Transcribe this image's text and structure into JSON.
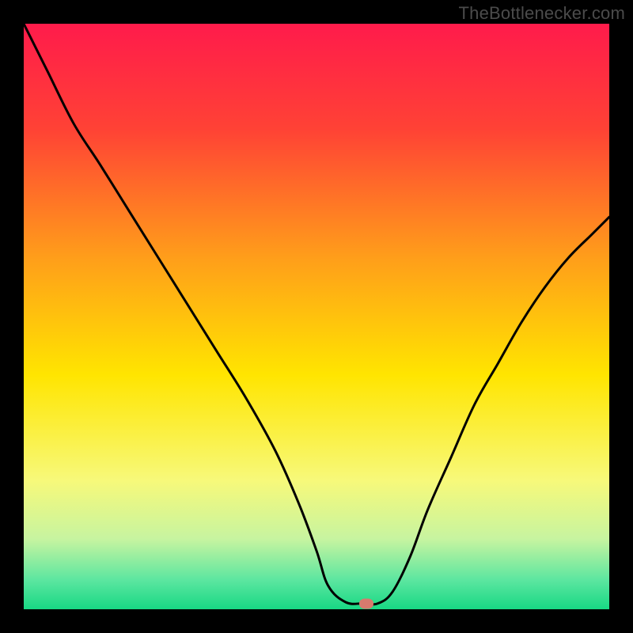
{
  "attribution": "TheBottlenecker.com",
  "chart_data": {
    "type": "line",
    "title": "",
    "xlabel": "",
    "ylabel": "",
    "xlim": [
      0,
      100
    ],
    "ylim": [
      0,
      100
    ],
    "gradient_stops": [
      {
        "offset": 0,
        "color": "#ff1b4b"
      },
      {
        "offset": 18,
        "color": "#ff4235"
      },
      {
        "offset": 40,
        "color": "#ff9e1a"
      },
      {
        "offset": 60,
        "color": "#ffe500"
      },
      {
        "offset": 78,
        "color": "#f7f97a"
      },
      {
        "offset": 88,
        "color": "#c7f4a0"
      },
      {
        "offset": 95,
        "color": "#5ce6a0"
      },
      {
        "offset": 100,
        "color": "#18d884"
      }
    ],
    "series": [
      {
        "name": "bottleneck-curve",
        "x": [
          0.0,
          4.0,
          8.5,
          13.0,
          18.0,
          23.0,
          28.0,
          33.0,
          38.0,
          43.0,
          47.0,
          50.0,
          52.0,
          55.0,
          58.0,
          60.5,
          63.0,
          66.0,
          69.0,
          73.0,
          77.0,
          81.0,
          85.0,
          89.0,
          93.0,
          97.0,
          100.0
        ],
        "y": [
          100.0,
          92.0,
          83.0,
          76.0,
          68.0,
          60.0,
          52.0,
          44.0,
          36.0,
          27.0,
          18.0,
          10.0,
          4.0,
          1.2,
          1.0,
          1.0,
          3.0,
          9.0,
          17.0,
          26.0,
          35.0,
          42.0,
          49.0,
          55.0,
          60.0,
          64.0,
          67.0
        ]
      }
    ],
    "marker": {
      "x": 58.5,
      "y": 1.0
    }
  }
}
